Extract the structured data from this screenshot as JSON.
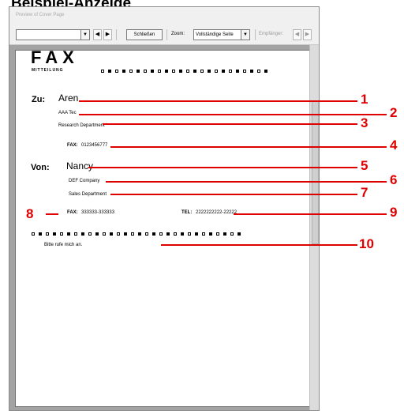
{
  "heading": "Beispiel-Anzeige",
  "window": {
    "title": "Preview of Cover Page"
  },
  "toolbar": {
    "page_combo_value": "",
    "close_label": "Schließen",
    "zoom_label": "Zoom:",
    "zoom_value": "Vollständige Seite",
    "recipient_label": "Empfänger:"
  },
  "cover": {
    "title": "FAX",
    "subtitle": "MITTEILUNG",
    "to_label": "Zu:",
    "to_name": "Aren",
    "to_company": "AAA Tec",
    "to_department": "Research Department",
    "to_fax_label": "FAX:",
    "to_fax": "0123456777",
    "from_label": "Von:",
    "from_name": "Nancy",
    "from_company": "DEF Company",
    "from_department": "Sales Department",
    "from_fax_label": "FAX:",
    "from_fax": "333333-333333",
    "from_tel_label": "TEL:",
    "from_tel": "2222222222-22222",
    "message": "Bitte rufe mich an."
  },
  "callouts": [
    "1",
    "2",
    "3",
    "4",
    "5",
    "6",
    "7",
    "8",
    "9",
    "10"
  ],
  "colors": {
    "callout": "#e00000",
    "viewport": "#a3a3a3"
  }
}
